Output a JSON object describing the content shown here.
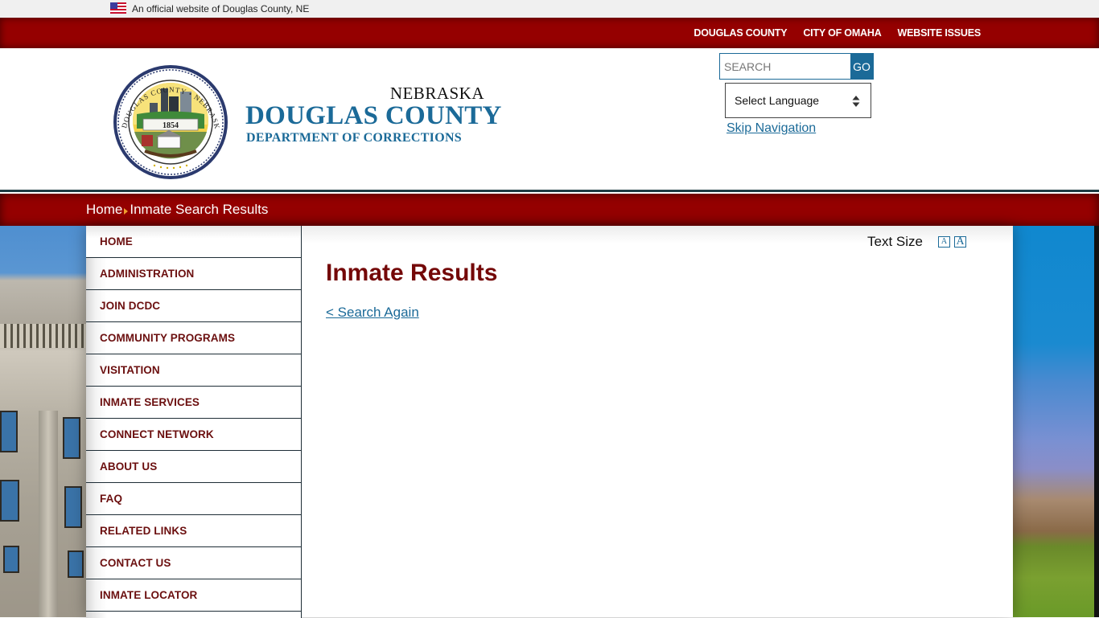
{
  "gov_banner": {
    "icon": "us-flag-icon",
    "text": "An official website of Douglas County, NE"
  },
  "top_links": [
    {
      "label": "DOUGLAS COUNTY"
    },
    {
      "label": "CITY OF OMAHA"
    },
    {
      "label": "WEBSITE ISSUES"
    }
  ],
  "header": {
    "seal": {
      "icon": "douglas-county-seal",
      "year": "1854",
      "ring_text": "DOUGLAS COUNTY • NEBRASKA"
    },
    "state": "NEBRASKA",
    "county": "DOUGLAS COUNTY",
    "department": "DEPARTMENT OF CORRECTIONS",
    "search": {
      "placeholder": "SEARCH",
      "value": "",
      "button_label": "GO"
    },
    "language_select": {
      "selected": "Select Language"
    },
    "skip_nav_label": "Skip Navigation"
  },
  "breadcrumb": {
    "items": [
      "Home",
      "Inmate Search Results"
    ],
    "separator_icon": "triangle-right-icon"
  },
  "sidebar": {
    "items": [
      {
        "label": "HOME"
      },
      {
        "label": "ADMINISTRATION"
      },
      {
        "label": "JOIN DCDC"
      },
      {
        "label": "COMMUNITY PROGRAMS"
      },
      {
        "label": "VISITATION"
      },
      {
        "label": "INMATE SERVICES"
      },
      {
        "label": "CONNECT NETWORK"
      },
      {
        "label": "ABOUT US"
      },
      {
        "label": "FAQ"
      },
      {
        "label": "RELATED LINKS"
      },
      {
        "label": "CONTACT US"
      },
      {
        "label": "INMATE LOCATOR"
      }
    ]
  },
  "main": {
    "text_size_label": "Text Size",
    "text_size_small": "A",
    "text_size_large": "A",
    "title": "Inmate Results",
    "search_again_label": "< Search Again"
  },
  "colors": {
    "brand_red": "#950000",
    "brand_blue": "#1b6a98",
    "title_red": "#740808",
    "nav_text": "#6b0f0f"
  }
}
